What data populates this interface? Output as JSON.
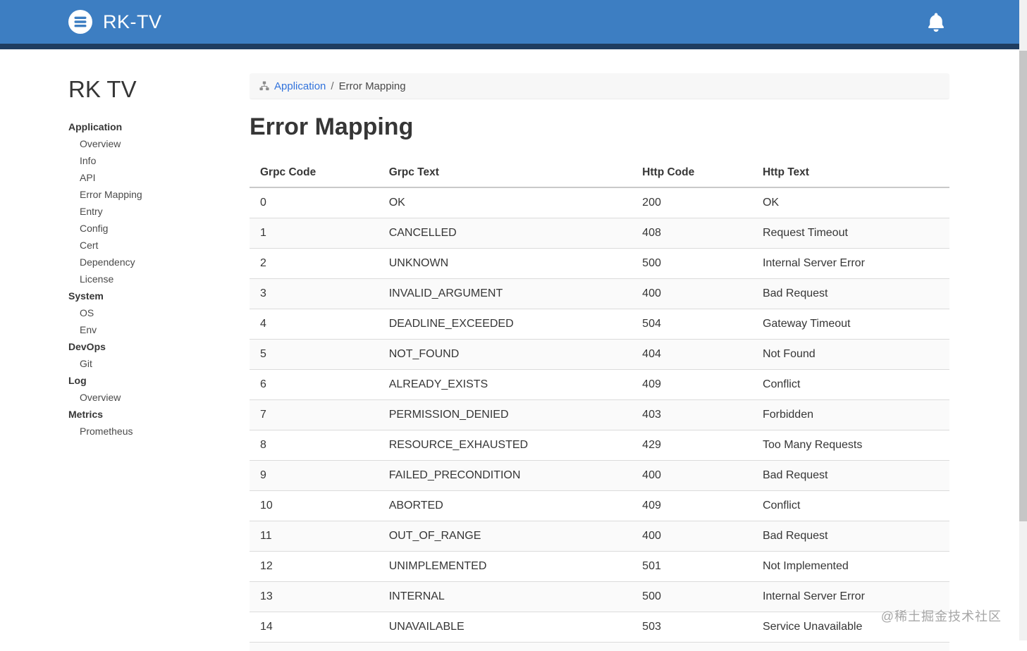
{
  "header": {
    "brand": "RK-TV",
    "brand_color": "#3d7ec2",
    "accent_color": "#1f3d60",
    "icons": {
      "logo": "list-circle-icon",
      "right": "notification-bell-icon"
    }
  },
  "sidebar": {
    "title": "RK TV",
    "sections": [
      {
        "label": "Application",
        "items": [
          "Overview",
          "Info",
          "API",
          "Error Mapping",
          "Entry",
          "Config",
          "Cert",
          "Dependency",
          "License"
        ]
      },
      {
        "label": "System",
        "items": [
          "OS",
          "Env"
        ]
      },
      {
        "label": "DevOps",
        "items": [
          "Git"
        ]
      },
      {
        "label": "Log",
        "items": [
          "Overview"
        ]
      },
      {
        "label": "Metrics",
        "items": [
          "Prometheus"
        ]
      }
    ]
  },
  "breadcrumb": {
    "parent": "Application",
    "separator": "/",
    "current": "Error Mapping"
  },
  "page": {
    "title": "Error Mapping"
  },
  "table": {
    "columns": [
      "Grpc Code",
      "Grpc Text",
      "Http Code",
      "Http Text"
    ],
    "rows": [
      [
        "0",
        "OK",
        "200",
        "OK"
      ],
      [
        "1",
        "CANCELLED",
        "408",
        "Request Timeout"
      ],
      [
        "2",
        "UNKNOWN",
        "500",
        "Internal Server Error"
      ],
      [
        "3",
        "INVALID_ARGUMENT",
        "400",
        "Bad Request"
      ],
      [
        "4",
        "DEADLINE_EXCEEDED",
        "504",
        "Gateway Timeout"
      ],
      [
        "5",
        "NOT_FOUND",
        "404",
        "Not Found"
      ],
      [
        "6",
        "ALREADY_EXISTS",
        "409",
        "Conflict"
      ],
      [
        "7",
        "PERMISSION_DENIED",
        "403",
        "Forbidden"
      ],
      [
        "8",
        "RESOURCE_EXHAUSTED",
        "429",
        "Too Many Requests"
      ],
      [
        "9",
        "FAILED_PRECONDITION",
        "400",
        "Bad Request"
      ],
      [
        "10",
        "ABORTED",
        "409",
        "Conflict"
      ],
      [
        "11",
        "OUT_OF_RANGE",
        "400",
        "Bad Request"
      ],
      [
        "12",
        "UNIMPLEMENTED",
        "501",
        "Not Implemented"
      ],
      [
        "13",
        "INTERNAL",
        "500",
        "Internal Server Error"
      ],
      [
        "14",
        "UNAVAILABLE",
        "503",
        "Service Unavailable"
      ]
    ]
  },
  "watermark": "@稀土掘金技术社区"
}
